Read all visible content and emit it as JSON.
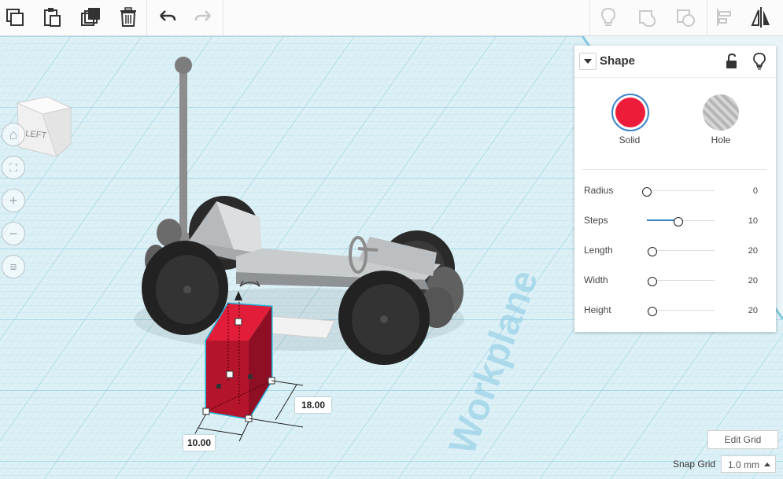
{
  "toolbar": {
    "left_actions": [
      {
        "name": "copy-button",
        "icon": "copy-icon"
      },
      {
        "name": "paste-button",
        "icon": "paste-icon"
      },
      {
        "name": "duplicate-button",
        "icon": "duplicate-icon"
      },
      {
        "name": "delete-button",
        "icon": "trash-icon"
      },
      {
        "name": "undo-button",
        "icon": "undo-icon"
      },
      {
        "name": "redo-button",
        "icon": "redo-icon"
      }
    ],
    "right_actions": [
      {
        "name": "show-hidden-button",
        "icon": "lightbulb-icon"
      },
      {
        "name": "group-button",
        "icon": "group-icon"
      },
      {
        "name": "ungroup-button",
        "icon": "ungroup-icon"
      },
      {
        "name": "align-button",
        "icon": "align-icon"
      },
      {
        "name": "mirror-button",
        "icon": "mirror-icon"
      }
    ]
  },
  "viewcube": {
    "face_label": "LEFT"
  },
  "nav_controls": [
    "home-view-icon",
    "fit-view-icon",
    "zoom-in-icon",
    "zoom-out-icon",
    "ortho-view-icon"
  ],
  "shape_panel": {
    "title": "Shape",
    "solid_label": "Solid",
    "hole_label": "Hole",
    "solid_color": "#ee1c3b",
    "properties": [
      {
        "label": "Radius",
        "value": "0",
        "level": 0
      },
      {
        "label": "Steps",
        "value": "10",
        "level": 0.45
      },
      {
        "label": "Length",
        "value": "20",
        "level": 0.08
      },
      {
        "label": "Width",
        "value": "20",
        "level": 0.08
      },
      {
        "label": "Height",
        "value": "20",
        "level": 0.08
      }
    ]
  },
  "dimensions": {
    "width": "10.00",
    "length": "18.00"
  },
  "workplane_label": "Workplane",
  "grid": {
    "edit_label": "Edit Grid",
    "snap_label": "Snap Grid",
    "snap_value": "1.0 mm"
  },
  "colors": {
    "accent": "#3d87c9",
    "selection": "#1fb3d8",
    "grid": "#cfe8f0"
  }
}
